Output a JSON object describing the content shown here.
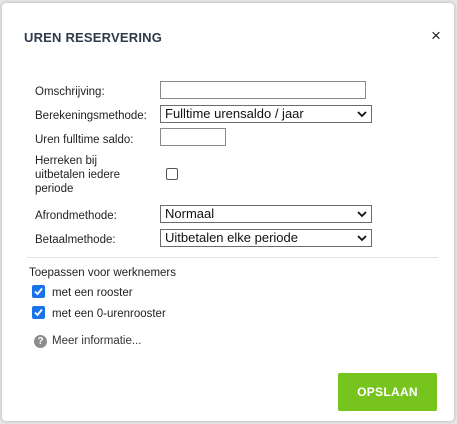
{
  "dialog": {
    "title": "UREN RESERVERING",
    "close_symbol": "×"
  },
  "form": {
    "omschrijving": {
      "label": "Omschrijving:",
      "value": ""
    },
    "berekeningsmethode": {
      "label": "Berekeningsmethode:",
      "selected": "Fulltime urensaldo / jaar"
    },
    "uren_fulltime_saldo": {
      "label": "Uren fulltime saldo:",
      "value": ""
    },
    "herreken": {
      "label_line1": "Herreken bij",
      "label_line2": "uitbetalen iedere",
      "label_line3": "periode",
      "checked": false
    },
    "afrondmethode": {
      "label": "Afrondmethode:",
      "selected": "Normaal"
    },
    "betaalmethode": {
      "label": "Betaalmethode:",
      "selected": "Uitbetalen elke periode"
    }
  },
  "toepassen": {
    "heading": "Toepassen voor werknemers",
    "options": [
      {
        "label": "met een rooster",
        "checked": true
      },
      {
        "label": "met een 0-urenrooster",
        "checked": true
      }
    ]
  },
  "help": {
    "icon": "question-circle-icon",
    "label": "Meer informatie..."
  },
  "actions": {
    "save_label": "OPSLAAN"
  },
  "colors": {
    "save_button": "#77c41f",
    "checkbox_checked": "#1a73e8",
    "title": "#2d3b4a"
  }
}
